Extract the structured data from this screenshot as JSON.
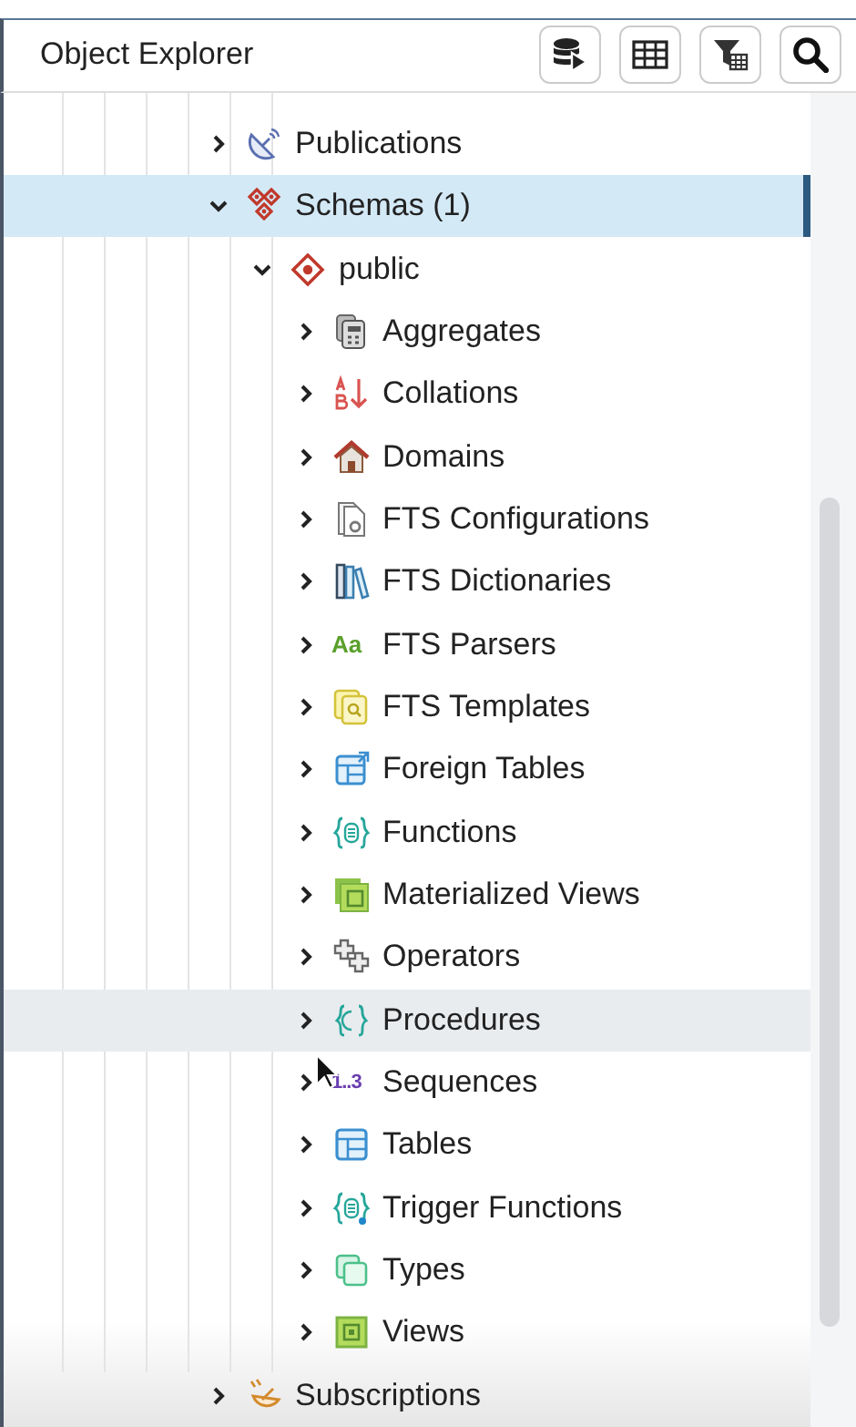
{
  "panel": {
    "title": "Object Explorer"
  },
  "tree": [
    {
      "label": "Publications",
      "expanded": false,
      "selected": false,
      "hovered": false
    },
    {
      "label": "Schemas (1)",
      "expanded": true,
      "selected": true,
      "hovered": false,
      "children": [
        {
          "label": "public",
          "expanded": true,
          "selected": false,
          "hovered": false,
          "children": [
            {
              "label": "Aggregates",
              "expanded": false,
              "selected": false,
              "hovered": false
            },
            {
              "label": "Collations",
              "expanded": false,
              "selected": false,
              "hovered": false
            },
            {
              "label": "Domains",
              "expanded": false,
              "selected": false,
              "hovered": false
            },
            {
              "label": "FTS Configurations",
              "expanded": false,
              "selected": false,
              "hovered": false
            },
            {
              "label": "FTS Dictionaries",
              "expanded": false,
              "selected": false,
              "hovered": false
            },
            {
              "label": "FTS Parsers",
              "icon_text": "Aa",
              "expanded": false,
              "selected": false,
              "hovered": false
            },
            {
              "label": "FTS Templates",
              "expanded": false,
              "selected": false,
              "hovered": false
            },
            {
              "label": "Foreign Tables",
              "expanded": false,
              "selected": false,
              "hovered": false
            },
            {
              "label": "Functions",
              "expanded": false,
              "selected": false,
              "hovered": false
            },
            {
              "label": "Materialized Views",
              "expanded": false,
              "selected": false,
              "hovered": false
            },
            {
              "label": "Operators",
              "expanded": false,
              "selected": false,
              "hovered": false
            },
            {
              "label": "Procedures",
              "expanded": false,
              "selected": false,
              "hovered": true
            },
            {
              "label": "Sequences",
              "icon_text": "1..3",
              "expanded": false,
              "selected": false,
              "hovered": false
            },
            {
              "label": "Tables",
              "expanded": false,
              "selected": false,
              "hovered": false
            },
            {
              "label": "Trigger Functions",
              "expanded": false,
              "selected": false,
              "hovered": false
            },
            {
              "label": "Types",
              "expanded": false,
              "selected": false,
              "hovered": false
            },
            {
              "label": "Views",
              "expanded": false,
              "selected": false,
              "hovered": false
            }
          ]
        }
      ]
    },
    {
      "label": "Subscriptions",
      "expanded": false,
      "selected": false,
      "hovered": false
    }
  ]
}
